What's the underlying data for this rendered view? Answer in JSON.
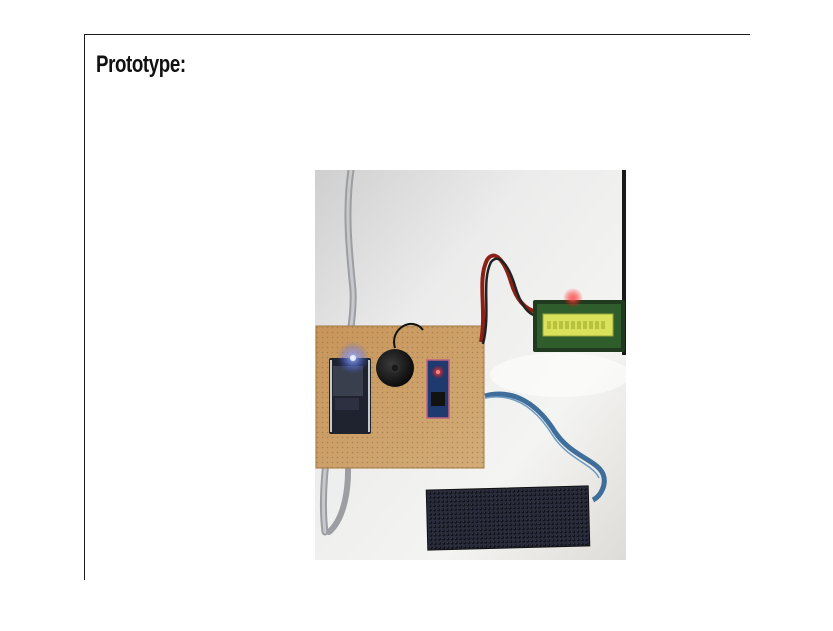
{
  "document": {
    "heading": "Prototype:"
  },
  "photo": {
    "subject": "prototype-circuit-photo",
    "colors": {
      "background": "#e8e6e1",
      "board": "#c79a5b",
      "lcd_screen": "#d8e34a",
      "led_matrix": "#1b1d2a",
      "cable": "#a5a7ab",
      "ribbon_cable": "#3f6e9a"
    }
  }
}
